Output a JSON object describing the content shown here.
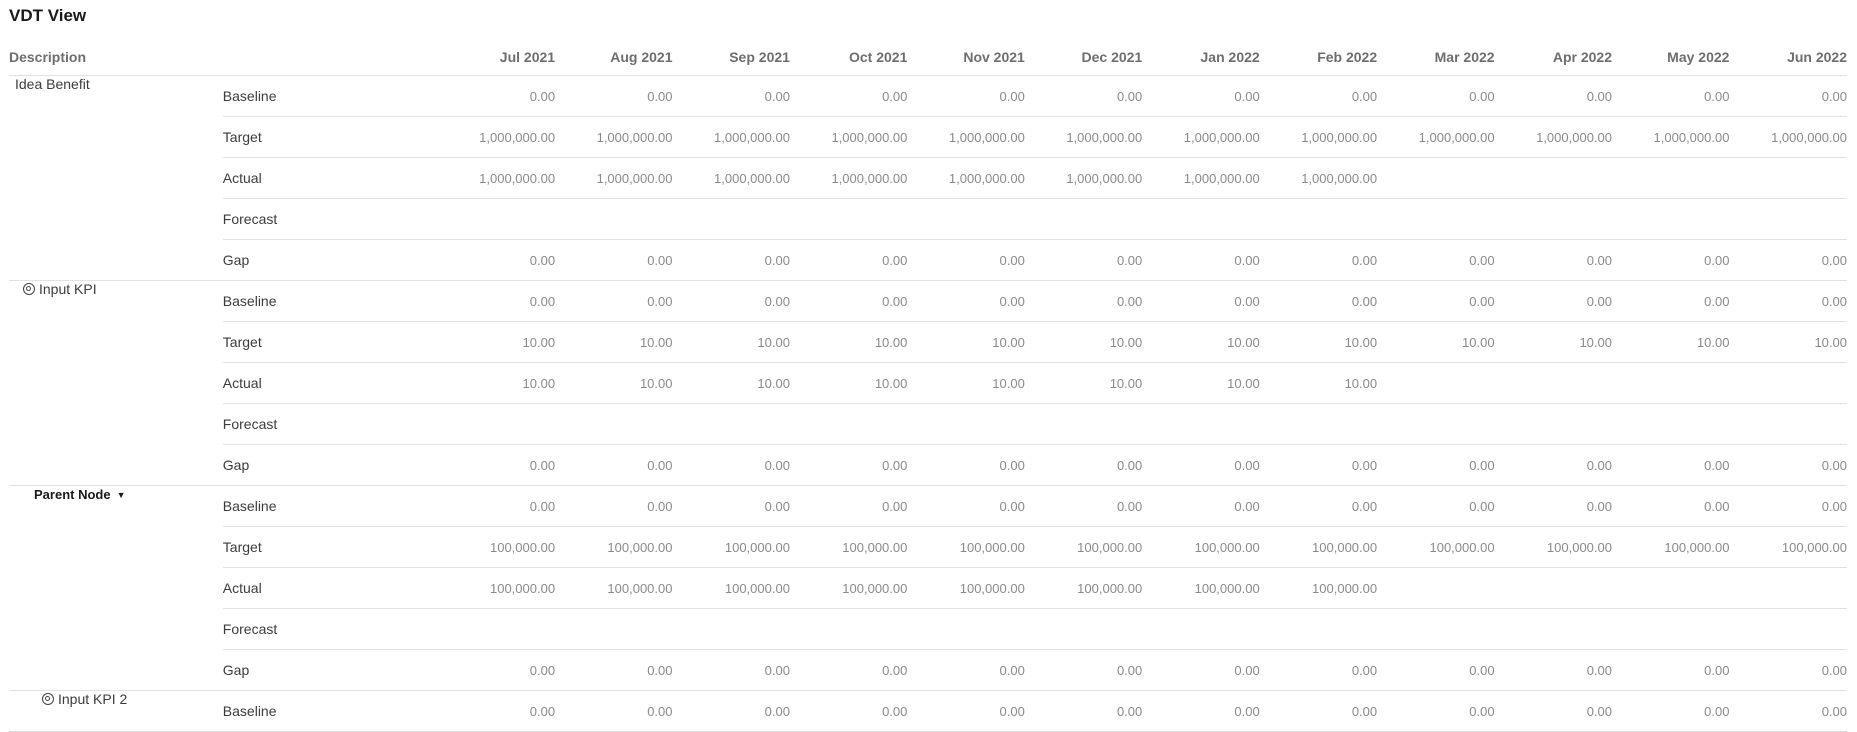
{
  "page": {
    "title": "VDT View"
  },
  "header": {
    "description": "Description",
    "months": [
      "Jul 2021",
      "Aug 2021",
      "Sep 2021",
      "Oct 2021",
      "Nov 2021",
      "Dec 2021",
      "Jan 2022",
      "Feb 2022",
      "Mar 2022",
      "Apr 2022",
      "May 2022",
      "Jun 2022"
    ]
  },
  "groups": [
    {
      "name": "Idea Benefit",
      "icon": "none",
      "rows": [
        {
          "label": "Baseline",
          "values": [
            "0.00",
            "0.00",
            "0.00",
            "0.00",
            "0.00",
            "0.00",
            "0.00",
            "0.00",
            "0.00",
            "0.00",
            "0.00",
            "0.00"
          ]
        },
        {
          "label": "Target",
          "values": [
            "1,000,000.00",
            "1,000,000.00",
            "1,000,000.00",
            "1,000,000.00",
            "1,000,000.00",
            "1,000,000.00",
            "1,000,000.00",
            "1,000,000.00",
            "1,000,000.00",
            "1,000,000.00",
            "1,000,000.00",
            "1,000,000.00"
          ]
        },
        {
          "label": "Actual",
          "values": [
            "1,000,000.00",
            "1,000,000.00",
            "1,000,000.00",
            "1,000,000.00",
            "1,000,000.00",
            "1,000,000.00",
            "1,000,000.00",
            "1,000,000.00",
            "",
            "",
            "",
            ""
          ]
        },
        {
          "label": "Forecast",
          "values": [
            "",
            "",
            "",
            "",
            "",
            "",
            "",
            "",
            "",
            "",
            "",
            ""
          ]
        },
        {
          "label": "Gap",
          "values": [
            "0.00",
            "0.00",
            "0.00",
            "0.00",
            "0.00",
            "0.00",
            "0.00",
            "0.00",
            "0.00",
            "0.00",
            "0.00",
            "0.00"
          ]
        }
      ]
    },
    {
      "name": "Input KPI",
      "icon": "target-icon",
      "rows": [
        {
          "label": "Baseline",
          "values": [
            "0.00",
            "0.00",
            "0.00",
            "0.00",
            "0.00",
            "0.00",
            "0.00",
            "0.00",
            "0.00",
            "0.00",
            "0.00",
            "0.00"
          ]
        },
        {
          "label": "Target",
          "values": [
            "10.00",
            "10.00",
            "10.00",
            "10.00",
            "10.00",
            "10.00",
            "10.00",
            "10.00",
            "10.00",
            "10.00",
            "10.00",
            "10.00"
          ]
        },
        {
          "label": "Actual",
          "values": [
            "10.00",
            "10.00",
            "10.00",
            "10.00",
            "10.00",
            "10.00",
            "10.00",
            "10.00",
            "",
            "",
            "",
            ""
          ]
        },
        {
          "label": "Forecast",
          "values": [
            "",
            "",
            "",
            "",
            "",
            "",
            "",
            "",
            "",
            "",
            "",
            ""
          ]
        },
        {
          "label": "Gap",
          "values": [
            "0.00",
            "0.00",
            "0.00",
            "0.00",
            "0.00",
            "0.00",
            "0.00",
            "0.00",
            "0.00",
            "0.00",
            "0.00",
            "0.00"
          ]
        }
      ]
    },
    {
      "name": "Parent Node",
      "icon": "caret-down-icon",
      "rows": [
        {
          "label": "Baseline",
          "values": [
            "0.00",
            "0.00",
            "0.00",
            "0.00",
            "0.00",
            "0.00",
            "0.00",
            "0.00",
            "0.00",
            "0.00",
            "0.00",
            "0.00"
          ]
        },
        {
          "label": "Target",
          "values": [
            "100,000.00",
            "100,000.00",
            "100,000.00",
            "100,000.00",
            "100,000.00",
            "100,000.00",
            "100,000.00",
            "100,000.00",
            "100,000.00",
            "100,000.00",
            "100,000.00",
            "100,000.00"
          ]
        },
        {
          "label": "Actual",
          "values": [
            "100,000.00",
            "100,000.00",
            "100,000.00",
            "100,000.00",
            "100,000.00",
            "100,000.00",
            "100,000.00",
            "100,000.00",
            "",
            "",
            "",
            ""
          ]
        },
        {
          "label": "Forecast",
          "values": [
            "",
            "",
            "",
            "",
            "",
            "",
            "",
            "",
            "",
            "",
            "",
            ""
          ]
        },
        {
          "label": "Gap",
          "values": [
            "0.00",
            "0.00",
            "0.00",
            "0.00",
            "0.00",
            "0.00",
            "0.00",
            "0.00",
            "0.00",
            "0.00",
            "0.00",
            "0.00"
          ]
        }
      ]
    },
    {
      "name": "Input KPI 2",
      "icon": "target-icon",
      "rows": [
        {
          "label": "Baseline",
          "values": [
            "0.00",
            "0.00",
            "0.00",
            "0.00",
            "0.00",
            "0.00",
            "0.00",
            "0.00",
            "0.00",
            "0.00",
            "0.00",
            "0.00"
          ]
        }
      ]
    }
  ]
}
